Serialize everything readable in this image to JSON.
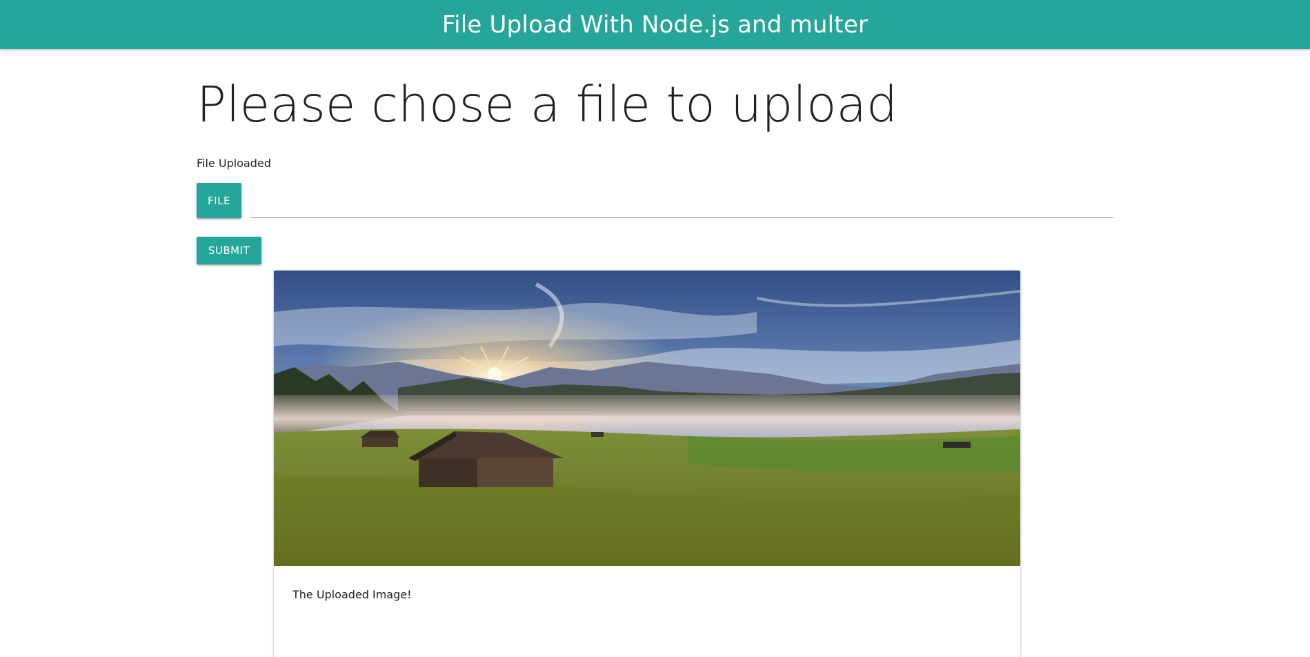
{
  "header": {
    "title": "File Upload With Node.js and multer",
    "color": "#26a69a"
  },
  "main": {
    "heading": "Please chose a file to upload",
    "status": "File Uploaded",
    "file_button_label": "FILE",
    "file_path_value": "",
    "submit_label": "SUBMIT"
  },
  "card": {
    "image_semantic": "landscape-photo",
    "caption": "The Uploaded Image!"
  }
}
